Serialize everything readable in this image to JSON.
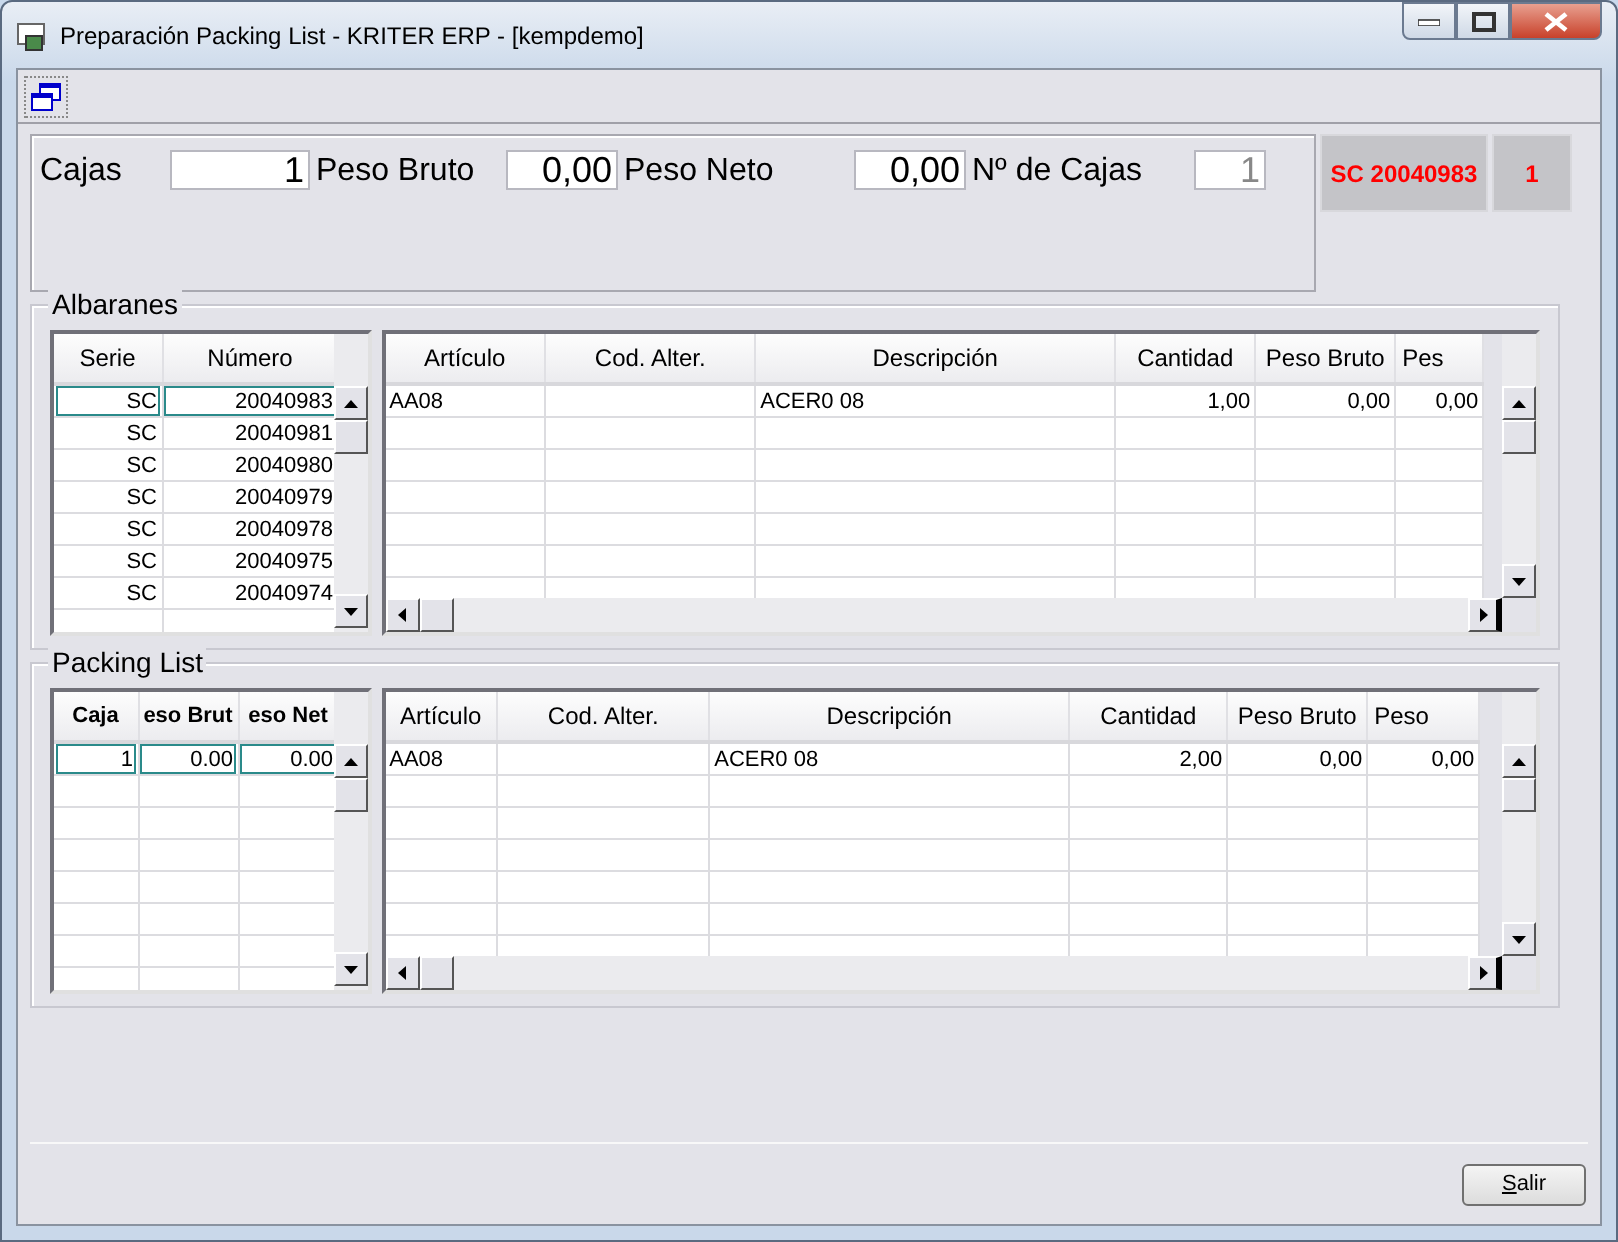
{
  "window": {
    "title": "Preparación Packing List - KRITER ERP - [kempdemo]"
  },
  "header": {
    "fields": [
      {
        "label": "Cajas",
        "value": "1",
        "disabled": false
      },
      {
        "label": "Peso Bruto",
        "value": "0,00",
        "disabled": false
      },
      {
        "label": "Peso Neto",
        "value": "0,00",
        "disabled": false
      },
      {
        "label": "Nº de Cajas",
        "value": "1",
        "disabled": true
      }
    ],
    "badges": [
      "SC 20040983",
      "1"
    ]
  },
  "albaranes": {
    "title": "Albaranes",
    "list": {
      "columns": [
        "Serie",
        "Número"
      ],
      "rows": [
        {
          "cells": [
            "SC",
            "20040983"
          ],
          "selected": true
        },
        {
          "cells": [
            "SC",
            "20040981"
          ],
          "selected": false
        },
        {
          "cells": [
            "SC",
            "20040980"
          ],
          "selected": false
        },
        {
          "cells": [
            "SC",
            "20040979"
          ],
          "selected": false
        },
        {
          "cells": [
            "SC",
            "20040978"
          ],
          "selected": false
        },
        {
          "cells": [
            "SC",
            "20040975"
          ],
          "selected": false
        },
        {
          "cells": [
            "SC",
            "20040974"
          ],
          "selected": false
        }
      ]
    },
    "detail": {
      "columns": [
        "Artículo",
        "Cod. Alter.",
        "Descripción",
        "Cantidad",
        "Peso Bruto",
        "Pes"
      ],
      "rows": [
        {
          "cells": [
            "AA08",
            null,
            "ACER0 08",
            "1,00",
            "0,00",
            "0,00"
          ]
        }
      ]
    }
  },
  "packing_list": {
    "title": "Packing List",
    "list": {
      "columns": [
        "Caja",
        "eso Brut",
        "eso Net"
      ],
      "rows": [
        {
          "cells": [
            "1",
            "0.00",
            "0.00"
          ],
          "selected": true
        }
      ]
    },
    "detail": {
      "columns": [
        "Artículo",
        "Cod. Alter.",
        "Descripción",
        "Cantidad",
        "Peso Bruto",
        "Peso"
      ],
      "rows": [
        {
          "cells": [
            "AA08",
            null,
            "ACER0 08",
            "2,00",
            "0,00",
            "0,00"
          ]
        }
      ]
    }
  },
  "buttons": [
    {
      "label": "Salir"
    }
  ]
}
